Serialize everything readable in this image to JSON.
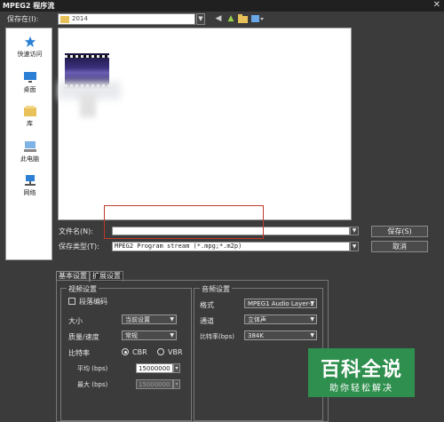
{
  "window": {
    "title": "MPEG2 程序流",
    "close_glyph": "✕"
  },
  "save_in": {
    "label": "保存在(I):",
    "value": "2014"
  },
  "places": [
    {
      "label": "快速访问",
      "icon": "star-icon"
    },
    {
      "label": "桌面",
      "icon": "desktop-icon"
    },
    {
      "label": "库",
      "icon": "library-icon"
    },
    {
      "label": "此电脑",
      "icon": "computer-icon"
    },
    {
      "label": "网络",
      "icon": "network-icon"
    }
  ],
  "file_name": {
    "label": "文件名(N):",
    "value": ""
  },
  "file_type": {
    "label": "保存类型(T):",
    "value": "MPEG2 Program stream (*.mpg;*.m2p)"
  },
  "buttons": {
    "save": "保存(S)",
    "cancel": "取消"
  },
  "tabs": [
    "基本设置",
    "扩展设置"
  ],
  "video": {
    "group_title": "视频设置",
    "field_coding": {
      "label": "段落编码",
      "checked": false
    },
    "size": {
      "label": "大小",
      "value": "当前设置"
    },
    "quality": {
      "label": "质量/速度",
      "value": "常规"
    },
    "bitrate": {
      "label": "比特率",
      "cbr": "CBR",
      "vbr": "VBR",
      "selected": "CBR"
    },
    "average": {
      "label": "平均 (bps)",
      "value": "15000000"
    },
    "max": {
      "label": "最大 (bps)",
      "value": "15000000"
    }
  },
  "audio": {
    "group_title": "音频设置",
    "format": {
      "label": "格式",
      "value": "MPEG1 Audio Layer-2"
    },
    "channel": {
      "label": "通道",
      "value": "立体声"
    },
    "bitrate": {
      "label": "比特率(bps)",
      "value": "384K"
    }
  },
  "watermark": {
    "title": "百科全说",
    "subtitle": "助你轻松解决"
  },
  "colors": {
    "highlight": "#c0392b",
    "watermark_bg": "#2f8f4e"
  }
}
